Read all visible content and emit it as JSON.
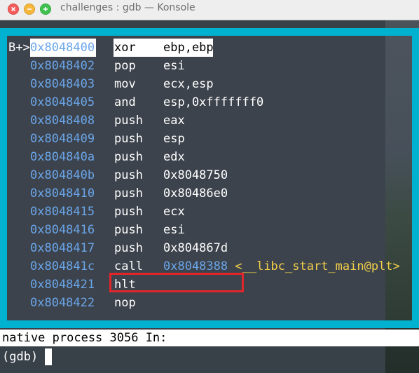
{
  "window": {
    "title": "challenges : gdb — Konsole"
  },
  "disassembly": {
    "current_marker": "B+>",
    "rows": [
      {
        "addr": "0x8048400",
        "mnem": "xor",
        "ops": "ebp,ebp",
        "current": true
      },
      {
        "addr": "0x8048402",
        "mnem": "pop",
        "ops": "esi"
      },
      {
        "addr": "0x8048403",
        "mnem": "mov",
        "ops": "ecx,esp"
      },
      {
        "addr": "0x8048405",
        "mnem": "and",
        "ops": "esp,0xfffffff0"
      },
      {
        "addr": "0x8048408",
        "mnem": "push",
        "ops": "eax"
      },
      {
        "addr": "0x8048409",
        "mnem": "push",
        "ops": "esp"
      },
      {
        "addr": "0x804840a",
        "mnem": "push",
        "ops": "edx"
      },
      {
        "addr": "0x804840b",
        "mnem": "push",
        "ops": "0x8048750"
      },
      {
        "addr": "0x8048410",
        "mnem": "push",
        "ops": "0x80486e0"
      },
      {
        "addr": "0x8048415",
        "mnem": "push",
        "ops": "ecx"
      },
      {
        "addr": "0x8048416",
        "mnem": "push",
        "ops": "esi"
      },
      {
        "addr": "0x8048417",
        "mnem": "push",
        "ops": "0x804867d",
        "highlighted": true
      },
      {
        "addr": "0x804841c",
        "mnem": "call",
        "ops_addr": "0x8048388",
        "symbol": "<__libc_start_main@plt>"
      },
      {
        "addr": "0x8048421",
        "mnem": "hlt",
        "ops": ""
      },
      {
        "addr": "0x8048422",
        "mnem": "nop",
        "ops": ""
      }
    ]
  },
  "status": {
    "text": "native process 3056 In:"
  },
  "command": {
    "prompt": "(gdb)",
    "value": ""
  },
  "colors": {
    "frame": "#00b2d0",
    "address": "#6aa6ea",
    "symbol": "#f3d04a",
    "highlight_box": "#e0262b"
  }
}
